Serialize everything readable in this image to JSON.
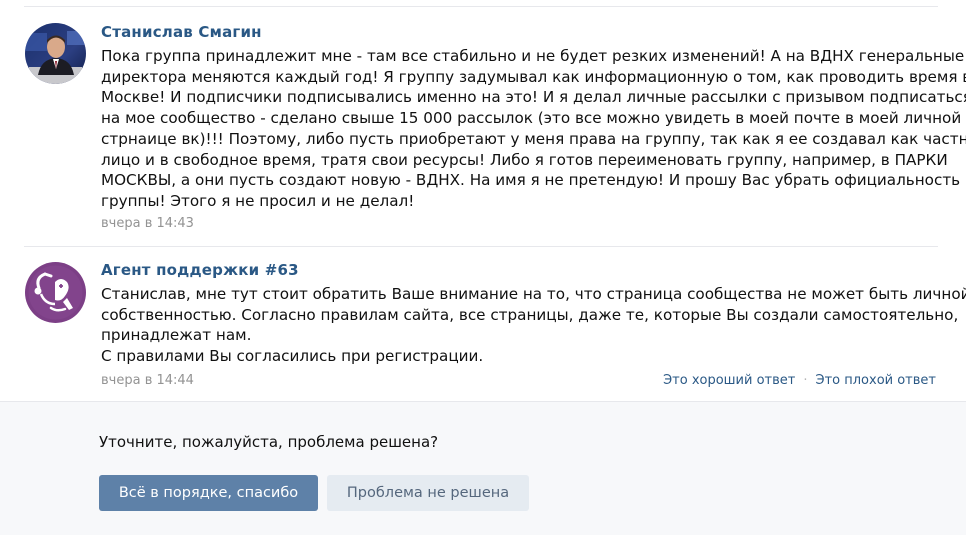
{
  "messages": [
    {
      "author": "Станислав Смагин",
      "avatar_icon": "user-photo-avatar",
      "text_lines": [
        "Пока группа принадлежит мне - там все стабильно и не будет резких изменений! А на ВДНХ генеральные",
        "директора меняются каждый год! Я группу задумывал как информационную о том, как проводить время в",
        "Москве! И подписчики подписывались именно на это! И я делал личные рассылки с призывом подписаться",
        "на мое сообщество - сделано свыше 15 000 рассылок (это все можно увидеть в моей почте в моей личной",
        "стрнаице вк)!!! Поэтому, либо пусть приобретают у меня права на группу, так как я ее создавал как частное",
        "лицо и в свободное время, тратя свои ресурсы! Либо я готов переименовать группу, например, в ПАРКИ",
        "МОСКВЫ, а они пусть создают новую - ВДНХ. На имя я не претендую! И прошу Вас убрать официальность",
        "группы! Этого я не просил и не делал!"
      ],
      "time": "вчера в 14:43"
    },
    {
      "author": "Агент поддержки #63",
      "avatar_icon": "support-agent-avatar",
      "text_lines": [
        "Станислав, мне тут стоит обратить Ваше внимание на то, что страница сообщества не может быть личной",
        "собственностью. Согласно правилам сайта, все страницы, даже те, которые Вы создали самостоятельно,",
        "принадлежат нам.",
        "С правилами Вы согласились при регистрации."
      ],
      "time": "вчера в 14:44",
      "actions": {
        "good": "Это хороший ответ",
        "separator": "·",
        "bad": "Это плохой ответ"
      }
    }
  ],
  "footer": {
    "question": "Уточните, пожалуйста, проблема решена?",
    "ok_button": "Всё в порядке, спасибо",
    "not_solved_button": "Проблема не решена"
  },
  "colors": {
    "link": "#2a5885",
    "primary_button": "#5e81a8",
    "secondary_button": "#e5ebf1",
    "muted": "#939393"
  }
}
